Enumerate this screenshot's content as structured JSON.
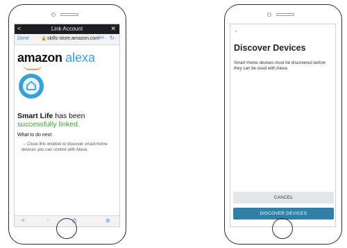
{
  "left_phone": {
    "nav": {
      "back": "<",
      "title": "Link Account",
      "close": "✕"
    },
    "url_bar": {
      "done": "Done",
      "lock_icon": "🔒",
      "url": "skills-store.amazon.com",
      "text_size": "AA",
      "reload_icon": "↻"
    },
    "logo": {
      "brand": "amazon",
      "product": "alexa"
    },
    "message": {
      "app_name": "Smart Life",
      "middle": " has been ",
      "status": "successfully linked."
    },
    "next": {
      "heading": "What to do next:",
      "text": "→ Close this window to discover smart-home devices you can control with Alexa."
    },
    "toolbar": {
      "back": "<",
      "forward": ">",
      "share": "⎙",
      "compass": "⊘"
    }
  },
  "right_phone": {
    "chevron": "⌄",
    "title": "Discover Devices",
    "description": "Smart Home devices must be discovered before they can be used with Alexa.",
    "cancel_button": "CANCEL",
    "discover_button": "DISCOVER DEVICES"
  },
  "colors": {
    "link_blue": "#2d7cf6",
    "alexa_blue": "#34a4d8",
    "success_green": "#3fa33a",
    "discover_button": "#2f7fa6",
    "cancel_button": "#e3e6e8",
    "smile_orange": "#f0a23a"
  }
}
